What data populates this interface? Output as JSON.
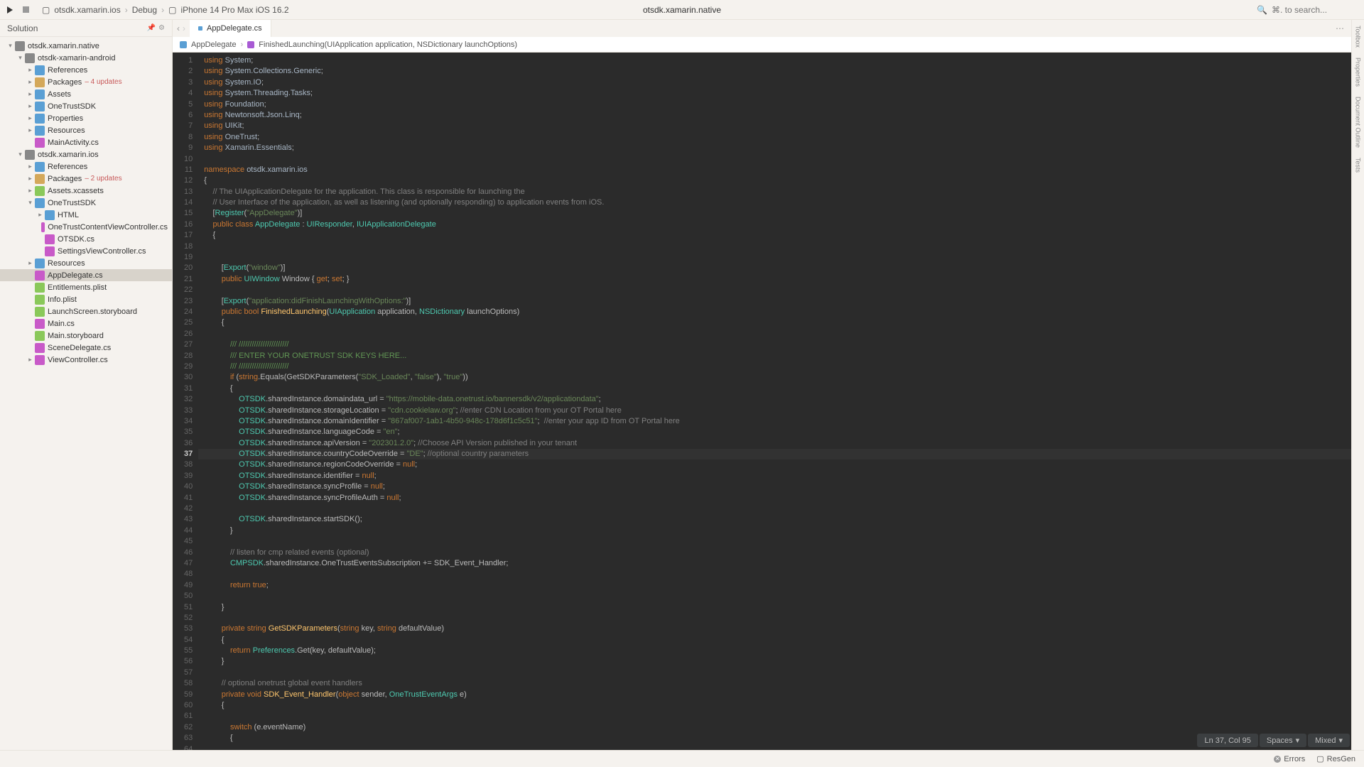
{
  "toolbar": {
    "project": "otsdk.xamarin.ios",
    "config": "Debug",
    "device": "iPhone 14 Pro Max iOS 16.2",
    "title": "otsdk.xamarin.native",
    "search_placeholder": "⌘. to search..."
  },
  "sidebar": {
    "title": "Solution",
    "root": "otsdk.xamarin.native",
    "android": {
      "name": "otsdk-xamarin-android",
      "items": [
        "References",
        "Packages",
        "Assets",
        "OneTrustSDK",
        "Properties",
        "Resources",
        "MainActivity.cs"
      ],
      "pkg_updates": "– 4 updates"
    },
    "ios": {
      "name": "otsdk.xamarin.ios",
      "items": [
        "References",
        "Packages",
        "Assets.xcassets"
      ],
      "pkg_updates": "– 2 updates",
      "onetrust": {
        "name": "OneTrustSDK",
        "items": [
          "HTML",
          "OneTrustContentViewController.cs",
          "OTSDK.cs",
          "SettingsViewController.cs"
        ]
      },
      "rest": [
        "Resources",
        "AppDelegate.cs",
        "Entitlements.plist",
        "Info.plist",
        "LaunchScreen.storyboard",
        "Main.cs",
        "Main.storyboard",
        "SceneDelegate.cs",
        "ViewController.cs"
      ]
    }
  },
  "tabs": {
    "active": "AppDelegate.cs"
  },
  "breadcrumb": {
    "class": "AppDelegate",
    "method": "FinishedLaunching(UIApplication application, NSDictionary launchOptions)"
  },
  "status": {
    "pos": "Ln 37, Col 95",
    "indent": "Spaces",
    "enc": "Mixed"
  },
  "bottom": {
    "errors": "Errors",
    "resgen": "ResGen"
  },
  "rail": [
    "Toolbox",
    "Properties",
    "Document Outline",
    "Tests"
  ],
  "code": {
    "current_line": 37,
    "lines": [
      {
        "n": 1,
        "h": "<span class='kw'>using</span> <span class='ns'>System</span>;"
      },
      {
        "n": 2,
        "h": "<span class='kw'>using</span> <span class='ns'>System.Collections.Generic</span>;"
      },
      {
        "n": 3,
        "h": "<span class='kw'>using</span> <span class='ns'>System.IO</span>;"
      },
      {
        "n": 4,
        "h": "<span class='kw'>using</span> <span class='ns'>System.Threading.Tasks</span>;"
      },
      {
        "n": 5,
        "h": "<span class='kw'>using</span> <span class='ns'>Foundation</span>;"
      },
      {
        "n": 6,
        "h": "<span class='kw'>using</span> <span class='ns'>Newtonsoft.Json.Linq</span>;"
      },
      {
        "n": 7,
        "h": "<span class='kw'>using</span> <span class='ns'>UIKit</span>;"
      },
      {
        "n": 8,
        "h": "<span class='kw'>using</span> <span class='ns'>OneTrust</span>;"
      },
      {
        "n": 9,
        "h": "<span class='kw'>using</span> <span class='ns'>Xamarin.Essentials</span>;"
      },
      {
        "n": 10,
        "h": ""
      },
      {
        "n": 11,
        "h": "<span class='kw'>namespace</span> <span class='ns'>otsdk.xamarin.ios</span>"
      },
      {
        "n": 12,
        "h": "{"
      },
      {
        "n": 13,
        "h": "    <span class='cmt'>// The UIApplicationDelegate for the application. This class is responsible for launching the</span>"
      },
      {
        "n": 14,
        "h": "    <span class='cmt'>// User Interface of the application, as well as listening (and optionally responding) to application events from iOS.</span>"
      },
      {
        "n": 15,
        "h": "    [<span class='cls'>Register</span>(<span class='str'>\"AppDelegate\"</span>)]"
      },
      {
        "n": 16,
        "h": "    <span class='kw'>public</span> <span class='kw'>class</span> <span class='cls'>AppDelegate</span> : <span class='cls'>UIResponder</span>, <span class='cls'>IUIApplicationDelegate</span>"
      },
      {
        "n": 17,
        "h": "    {"
      },
      {
        "n": 18,
        "h": ""
      },
      {
        "n": 19,
        "h": ""
      },
      {
        "n": 20,
        "h": "        [<span class='cls'>Export</span>(<span class='str'>\"window\"</span>)]"
      },
      {
        "n": 21,
        "h": "        <span class='kw'>public</span> <span class='cls'>UIWindow</span> Window { <span class='kw'>get</span>; <span class='kw'>set</span>; }"
      },
      {
        "n": 22,
        "h": ""
      },
      {
        "n": 23,
        "h": "        [<span class='cls'>Export</span>(<span class='str'>\"application:didFinishLaunchingWithOptions:\"</span>)]"
      },
      {
        "n": 24,
        "h": "        <span class='kw'>public</span> <span class='kw'>bool</span> <span class='fn'>FinishedLaunching</span>(<span class='cls'>UIApplication</span> application, <span class='cls'>NSDictionary</span> launchOptions)"
      },
      {
        "n": 25,
        "h": "        {"
      },
      {
        "n": 26,
        "h": ""
      },
      {
        "n": 27,
        "h": "            <span class='xmlc'>/// ///////////////////////</span>"
      },
      {
        "n": 28,
        "h": "            <span class='xmlc'>/// ENTER YOUR ONETRUST SDK KEYS HERE...</span>"
      },
      {
        "n": 29,
        "h": "            <span class='xmlc'>/// ///////////////////////</span>"
      },
      {
        "n": 30,
        "h": "            <span class='kw'>if</span> (<span class='kw'>string</span>.Equals(GetSDKParameters(<span class='str'>\"SDK_Loaded\"</span>, <span class='str'>\"false\"</span>), <span class='str'>\"true\"</span>))"
      },
      {
        "n": 31,
        "h": "            {"
      },
      {
        "n": 32,
        "h": "                <span class='cls'>OTSDK</span>.sharedInstance.domaindata_url = <span class='str'>\"https://mobile-data.onetrust.io/bannersdk/v2/applicationdata\"</span>;"
      },
      {
        "n": 33,
        "h": "                <span class='cls'>OTSDK</span>.sharedInstance.storageLocation = <span class='str'>\"cdn.cookielaw.org\"</span>; <span class='cmt'>//enter CDN Location from your OT Portal here</span>"
      },
      {
        "n": 34,
        "h": "                <span class='cls'>OTSDK</span>.sharedInstance.domainIdentifier = <span class='str'>\"867af007-1ab1-4b50-948c-178d6f1c5c51\"</span>;  <span class='cmt'>//enter your app ID from OT Portal here</span>"
      },
      {
        "n": 35,
        "h": "                <span class='cls'>OTSDK</span>.sharedInstance.languageCode = <span class='str'>\"en\"</span>;"
      },
      {
        "n": 36,
        "h": "                <span class='cls'>OTSDK</span>.sharedInstance.apiVersion = <span class='str'>\"202301.2.0\"</span>; <span class='cmt'>//Choose API Version published in your tenant</span>"
      },
      {
        "n": 37,
        "h": "                <span class='cls'>OTSDK</span>.sharedInstance.countryCodeOverride = <span class='str'>\"DE\"</span>; <span class='cmt'>//optional country parameters</span>"
      },
      {
        "n": 38,
        "h": "                <span class='cls'>OTSDK</span>.sharedInstance.regionCodeOverride = <span class='kw'>null</span>;"
      },
      {
        "n": 39,
        "h": "                <span class='cls'>OTSDK</span>.sharedInstance.identifier = <span class='kw'>null</span>;"
      },
      {
        "n": 40,
        "h": "                <span class='cls'>OTSDK</span>.sharedInstance.syncProfile = <span class='kw'>null</span>;"
      },
      {
        "n": 41,
        "h": "                <span class='cls'>OTSDK</span>.sharedInstance.syncProfileAuth = <span class='kw'>null</span>;"
      },
      {
        "n": 42,
        "h": ""
      },
      {
        "n": 43,
        "h": "                <span class='cls'>OTSDK</span>.sharedInstance.startSDK();"
      },
      {
        "n": 44,
        "h": "            }"
      },
      {
        "n": 45,
        "h": ""
      },
      {
        "n": 46,
        "h": "            <span class='cmt'>// listen for cmp related events (optional)</span>"
      },
      {
        "n": 47,
        "h": "            <span class='cls'>CMPSDK</span>.sharedInstance.OneTrustEventsSubscription += SDK_Event_Handler;"
      },
      {
        "n": 48,
        "h": ""
      },
      {
        "n": 49,
        "h": "            <span class='kw'>return</span> <span class='kw'>true</span>;"
      },
      {
        "n": 50,
        "h": ""
      },
      {
        "n": 51,
        "h": "        }"
      },
      {
        "n": 52,
        "h": ""
      },
      {
        "n": 53,
        "h": "        <span class='kw'>private</span> <span class='kw'>string</span> <span class='fn'>GetSDKParameters</span>(<span class='kw'>string</span> key, <span class='kw'>string</span> defaultValue)"
      },
      {
        "n": 54,
        "h": "        {"
      },
      {
        "n": 55,
        "h": "            <span class='kw'>return</span> <span class='cls'>Preferences</span>.Get(key, defaultValue);"
      },
      {
        "n": 56,
        "h": "        }"
      },
      {
        "n": 57,
        "h": ""
      },
      {
        "n": 58,
        "h": "        <span class='cmt'>// optional onetrust global event handlers</span>"
      },
      {
        "n": 59,
        "h": "        <span class='kw'>private</span> <span class='kw'>void</span> <span class='fn'>SDK_Event_Handler</span>(<span class='kw'>object</span> sender, <span class='cls'>OneTrustEventArgs</span> e)"
      },
      {
        "n": 60,
        "h": "        {"
      },
      {
        "n": 61,
        "h": ""
      },
      {
        "n": 62,
        "h": "            <span class='kw'>switch</span> (e.eventName)"
      },
      {
        "n": 63,
        "h": "            {"
      },
      {
        "n": 64,
        "h": ""
      }
    ]
  }
}
